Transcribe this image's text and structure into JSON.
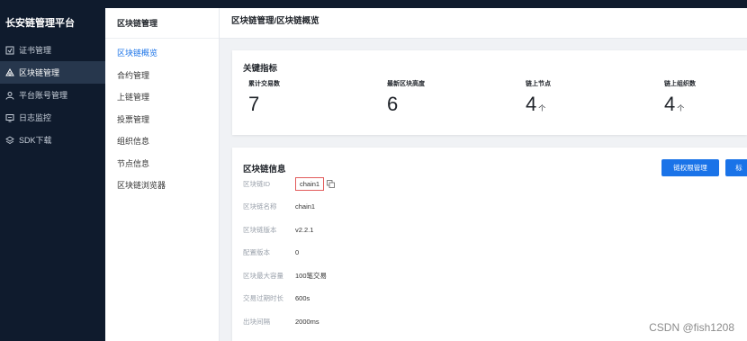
{
  "brand": "长安链管理平台",
  "sidebar": {
    "items": [
      {
        "label": "证书管理",
        "icon": "certificate-icon",
        "active": false
      },
      {
        "label": "区块链管理",
        "icon": "blockchain-icon",
        "active": true
      },
      {
        "label": "平台账号管理",
        "icon": "user-icon",
        "active": false
      },
      {
        "label": "日志监控",
        "icon": "monitor-icon",
        "active": false
      },
      {
        "label": "SDK下载",
        "icon": "layers-icon",
        "active": false
      }
    ]
  },
  "subnav": {
    "title": "区块链管理",
    "items": [
      {
        "label": "区块链概览",
        "active": true
      },
      {
        "label": "合约管理",
        "active": false
      },
      {
        "label": "上链管理",
        "active": false
      },
      {
        "label": "投票管理",
        "active": false
      },
      {
        "label": "组织信息",
        "active": false
      },
      {
        "label": "节点信息",
        "active": false
      },
      {
        "label": "区块链浏览器",
        "active": false
      }
    ]
  },
  "header": {
    "breadcrumb": "区块链管理/区块链概览"
  },
  "key_metrics": {
    "title": "关键指标",
    "items": [
      {
        "label": "累计交易数",
        "value": "7",
        "unit": ""
      },
      {
        "label": "最新区块高度",
        "value": "6",
        "unit": ""
      },
      {
        "label": "链上节点",
        "value": "4",
        "unit": "个"
      },
      {
        "label": "链上组织数",
        "value": "4",
        "unit": "个"
      }
    ]
  },
  "chain_info": {
    "title": "区块链信息",
    "buttons": {
      "permission": "链权限管理",
      "second": "标"
    },
    "rows": [
      {
        "label": "区块链ID",
        "value": "chain1"
      },
      {
        "label": "区块链名称",
        "value": "chain1"
      },
      {
        "label": "区块链版本",
        "value": "v2.2.1"
      },
      {
        "label": "配置版本",
        "value": "0"
      },
      {
        "label": "区块最大容量",
        "value": "100笔交易"
      },
      {
        "label": "交易过期时长",
        "value": "600s"
      },
      {
        "label": "出块间隔",
        "value": "2000ms"
      }
    ]
  },
  "watermark": "CSDN @fish1208",
  "colors": {
    "sidebar_bg": "#0f1b2d",
    "accent": "#1a73e8",
    "highlight_border": "#e25b5b"
  }
}
